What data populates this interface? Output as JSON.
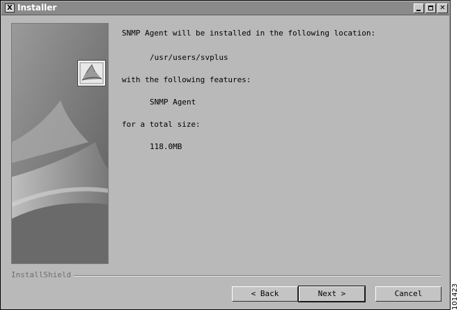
{
  "window": {
    "title": "Installer",
    "icon": "x-window-icon"
  },
  "summary": {
    "intro": "SNMP Agent will be installed in the following location:",
    "location": "/usr/users/svplus",
    "features_label": "with the following features:",
    "feature": "SNMP Agent",
    "size_label": "for a total size:",
    "size": "118.0MB"
  },
  "branding": {
    "label": "InstallShield"
  },
  "buttons": {
    "back": "< Back",
    "next": "Next >",
    "cancel": "Cancel"
  },
  "figure_number": "101423"
}
